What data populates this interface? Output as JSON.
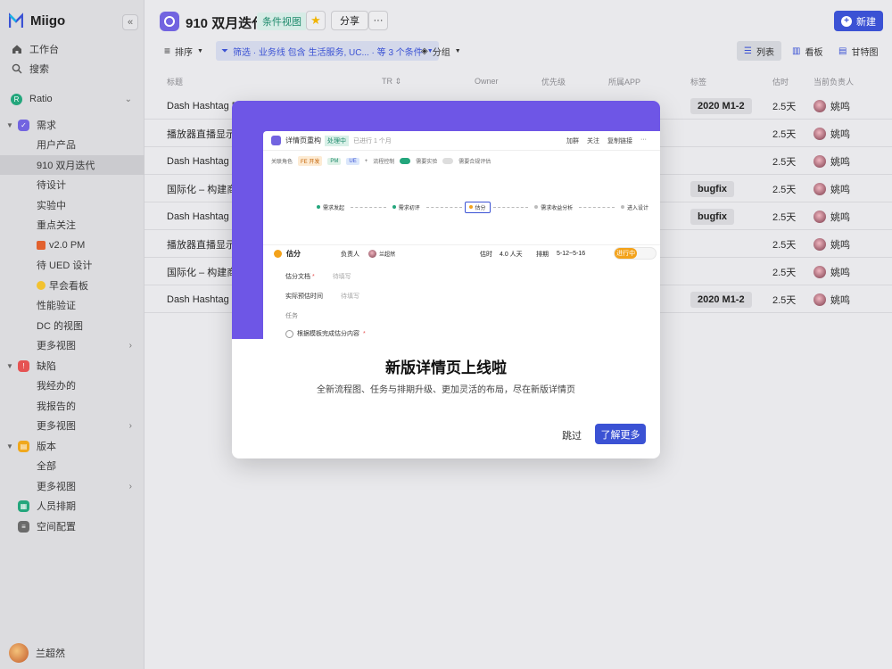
{
  "app": {
    "name": "Miigo",
    "collapse_glyph": "«"
  },
  "sidebar": {
    "top_items": [
      {
        "label": "工作台",
        "icon": "home-icon"
      },
      {
        "label": "搜索",
        "icon": "search-icon"
      }
    ],
    "workspace": {
      "label": "Ratio",
      "badge": "R"
    },
    "groups": [
      {
        "label": "需求",
        "icon": "requirement-icon",
        "color": "#7264e0",
        "items": [
          "用户产品",
          "910 双月迭代",
          "待设计",
          "实验中",
          "重点关注",
          "v2.0 PM",
          "待 UED 设计",
          "早会看板",
          "性能验证",
          "DC 的视图",
          "更多视图"
        ]
      },
      {
        "label": "缺陷",
        "icon": "bug-icon",
        "color": "#e55353",
        "items": [
          "我经办的",
          "我报告的",
          "更多视图"
        ]
      },
      {
        "label": "版本",
        "icon": "version-icon",
        "color": "#f0a81c",
        "items": [
          "全部",
          "更多视图"
        ]
      }
    ],
    "bottom_items": [
      {
        "label": "人员排期",
        "icon": "schedule-icon",
        "color": "#23a67c"
      },
      {
        "label": "空间配置",
        "icon": "settings-icon",
        "color": "#6b6b6b"
      }
    ],
    "user": {
      "name": "兰超然"
    }
  },
  "header": {
    "title": "910 双月迭代",
    "view_badge": "条件视图",
    "share": "分享",
    "more": "···",
    "new_button": "新建",
    "toolbar": {
      "sort": "排序",
      "filter": "筛选 · 业务线 包含 生活服务, UC... · 等 3 个条件",
      "group": "分组"
    },
    "views": [
      {
        "label": "列表",
        "active": true
      },
      {
        "label": "看板",
        "active": false
      },
      {
        "label": "甘特图",
        "active": false
      }
    ]
  },
  "table": {
    "columns": [
      "标题",
      "TR",
      "Owner",
      "优先级",
      "所属APP",
      "标签",
      "估时",
      "当前负责人"
    ],
    "rows": [
      {
        "title": "Dash Hashtag R",
        "tag": "2020 M1-2",
        "estimate": "2.5天",
        "assignee": "姚鸣"
      },
      {
        "title": "播放器直播显示",
        "tag": "",
        "estimate": "2.5天",
        "assignee": "姚鸣"
      },
      {
        "title": "Dash Hashtag R",
        "tag": "",
        "estimate": "2.5天",
        "assignee": "姚鸣"
      },
      {
        "title": "国际化 – 构建商",
        "tag": "bugfix",
        "estimate": "2.5天",
        "assignee": "姚鸣"
      },
      {
        "title": "Dash Hashtag R",
        "tag": "bugfix",
        "estimate": "2.5天",
        "assignee": "姚鸣"
      },
      {
        "title": "播放器直播显示",
        "tag": "",
        "estimate": "2.5天",
        "assignee": "姚鸣"
      },
      {
        "title": "国际化 – 构建商",
        "tag": "",
        "estimate": "2.5天",
        "assignee": "姚鸣"
      },
      {
        "title": "Dash Hashtag R",
        "tag": "2020 M1-2",
        "estimate": "2.5天",
        "assignee": "姚鸣"
      }
    ]
  },
  "modal": {
    "title": "新版详情页上线啦",
    "description": "全新流程图、任务与排期升级、更加灵活的布局，尽在新版详情页",
    "skip": "跳过",
    "learn_more": "了解更多",
    "preview": {
      "title": "详情页重构",
      "status": "处理中",
      "meta": "已进行 1 个月",
      "actions": [
        "加群",
        "关注",
        "复制链接",
        "···"
      ],
      "roles_label": "关联角色",
      "roles": [
        "FE 开发",
        "PM",
        "UE",
        "+"
      ],
      "process_label": "流程控制",
      "experiment_label": "需要实验",
      "review_label": "需要合规评估",
      "flow": [
        "需求发起",
        "需求初评",
        "估分",
        "需求收益分析",
        "进入设计"
      ],
      "task": {
        "name": "估分",
        "owner_label": "负责人",
        "owner": "兰超然",
        "estimate_label": "估时",
        "estimate": "4.0 人天",
        "schedule_label": "排期",
        "schedule": "5-12~5-16",
        "status": "进行中",
        "progress": 0.55
      },
      "fields": [
        {
          "label": "估分文档",
          "placeholder": "待填写"
        },
        {
          "label": "实际预估时间",
          "placeholder": "待填写"
        }
      ],
      "task_section": "任务",
      "task_item": "根据模板完成估分内容"
    }
  },
  "colors": {
    "brand": "#3b52d4",
    "hero": "#6e56e6",
    "accent_purple": "#7264e0",
    "progress": "#f3a21a"
  }
}
